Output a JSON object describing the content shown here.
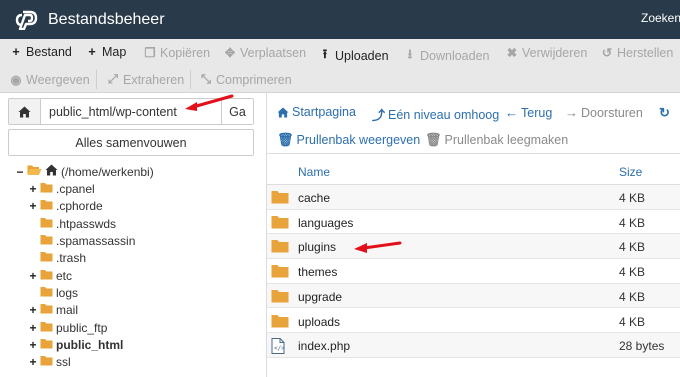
{
  "app": {
    "title": "Bestandsbeheer",
    "search_label": "Zoeken"
  },
  "toolbar": {
    "row1": [
      {
        "label": "Bestand",
        "icon": "plus-icon",
        "disabled": false
      },
      {
        "label": "Map",
        "icon": "plus-icon",
        "disabled": false
      },
      {
        "label": "Kopiëren",
        "icon": "copy-icon",
        "disabled": true
      },
      {
        "label": "Verplaatsen",
        "icon": "move-icon",
        "disabled": true
      },
      {
        "label": "Uploaden",
        "icon": "upload-icon",
        "disabled": false
      },
      {
        "label": "Downloaden",
        "icon": "download-icon",
        "disabled": true
      },
      {
        "label": "Verwijderen",
        "icon": "times-icon",
        "disabled": true
      },
      {
        "label": "Herstellen",
        "icon": "undo-icon",
        "disabled": true
      }
    ],
    "row2": [
      {
        "label": "Weergeven",
        "icon": "eye-icon",
        "disabled": true
      },
      {
        "label": "Extraheren",
        "icon": "expand-icon",
        "disabled": true
      },
      {
        "label": "Comprimeren",
        "icon": "compress-icon",
        "disabled": true
      }
    ]
  },
  "path_bar": {
    "value": "public_html/wp-content",
    "go_label": "Ga"
  },
  "collapse_label": "Alles samenvouwen",
  "tree": [
    {
      "label": "(/home/werkenbi)",
      "toggle": "−",
      "open": true,
      "home": true,
      "bold": false
    },
    {
      "label": ".cpanel",
      "toggle": "+",
      "bold": false
    },
    {
      "label": ".cphorde",
      "toggle": "+",
      "bold": false
    },
    {
      "label": ".htpasswds",
      "toggle": "",
      "bold": false
    },
    {
      "label": ".spamassassin",
      "toggle": "",
      "bold": false
    },
    {
      "label": ".trash",
      "toggle": "",
      "bold": false
    },
    {
      "label": "etc",
      "toggle": "+",
      "bold": false
    },
    {
      "label": "logs",
      "toggle": "",
      "bold": false
    },
    {
      "label": "mail",
      "toggle": "+",
      "bold": false
    },
    {
      "label": "public_ftp",
      "toggle": "+",
      "bold": false
    },
    {
      "label": "public_html",
      "toggle": "+",
      "bold": true
    },
    {
      "label": "ssl",
      "toggle": "+",
      "bold": false
    }
  ],
  "nav": {
    "row1": [
      {
        "label": "Startpagina",
        "icon": "home-icon"
      },
      {
        "label": "Eén niveau omhoog",
        "icon": "level-up-icon"
      },
      {
        "label": "Terug",
        "icon": "arrow-left-icon"
      },
      {
        "label": "Doorsturen",
        "icon": "arrow-right-icon"
      },
      {
        "label": "",
        "icon": "refresh-icon"
      }
    ],
    "row2": [
      {
        "label": "Prullenbak weergeven",
        "icon": "trash-icon"
      },
      {
        "label": "Prullenbak leegmaken",
        "icon": "trash-icon"
      }
    ]
  },
  "table": {
    "headers": {
      "name": "Name",
      "size": "Size"
    },
    "rows": [
      {
        "name": "cache",
        "size": "4 KB",
        "type": "folder"
      },
      {
        "name": "languages",
        "size": "4 KB",
        "type": "folder"
      },
      {
        "name": "plugins",
        "size": "4 KB",
        "type": "folder"
      },
      {
        "name": "themes",
        "size": "4 KB",
        "type": "folder"
      },
      {
        "name": "upgrade",
        "size": "4 KB",
        "type": "folder"
      },
      {
        "name": "uploads",
        "size": "4 KB",
        "type": "folder"
      },
      {
        "name": "index.php",
        "size": "28 bytes",
        "type": "php"
      }
    ]
  },
  "colors": {
    "header_bg": "#293a4a",
    "toolbar_bg": "#e8e8e8",
    "link_blue": "#2d6fad",
    "folder_orange": "#e8a33a",
    "annotation_red": "#e3101a"
  }
}
